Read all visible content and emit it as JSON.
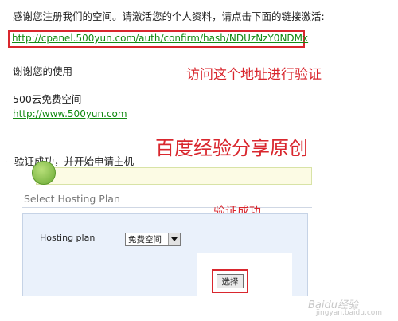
{
  "email": {
    "intro": "感谢您注册我们的空间。请激活您的个人资料，请点击下面的链接激活:",
    "confirm_link": "http://cpanel.500yun.com/auth/confirm/hash/NDUzNzY0NDMx",
    "thanks": "谢谢您的使用",
    "brand": "500云免费空间",
    "site_link": "http://www.500yun.com"
  },
  "annotations": {
    "visit": "访问这个地址进行验证",
    "baidu": "百度经验分享原创",
    "success": "验证成功"
  },
  "step": {
    "text": "验证成功，并开始申请主机"
  },
  "hosting": {
    "section_title": "Select Hosting Plan",
    "plan_label": "Hosting plan",
    "plan_selected": "免费空间",
    "submit_label": "选择"
  },
  "watermark": {
    "logo": "Baidu经验",
    "url": "jingyan.baidu.com"
  },
  "colors": {
    "annotation_red": "#d9272e",
    "link_green": "#128a12",
    "panel_bg": "#eaf1fb"
  }
}
